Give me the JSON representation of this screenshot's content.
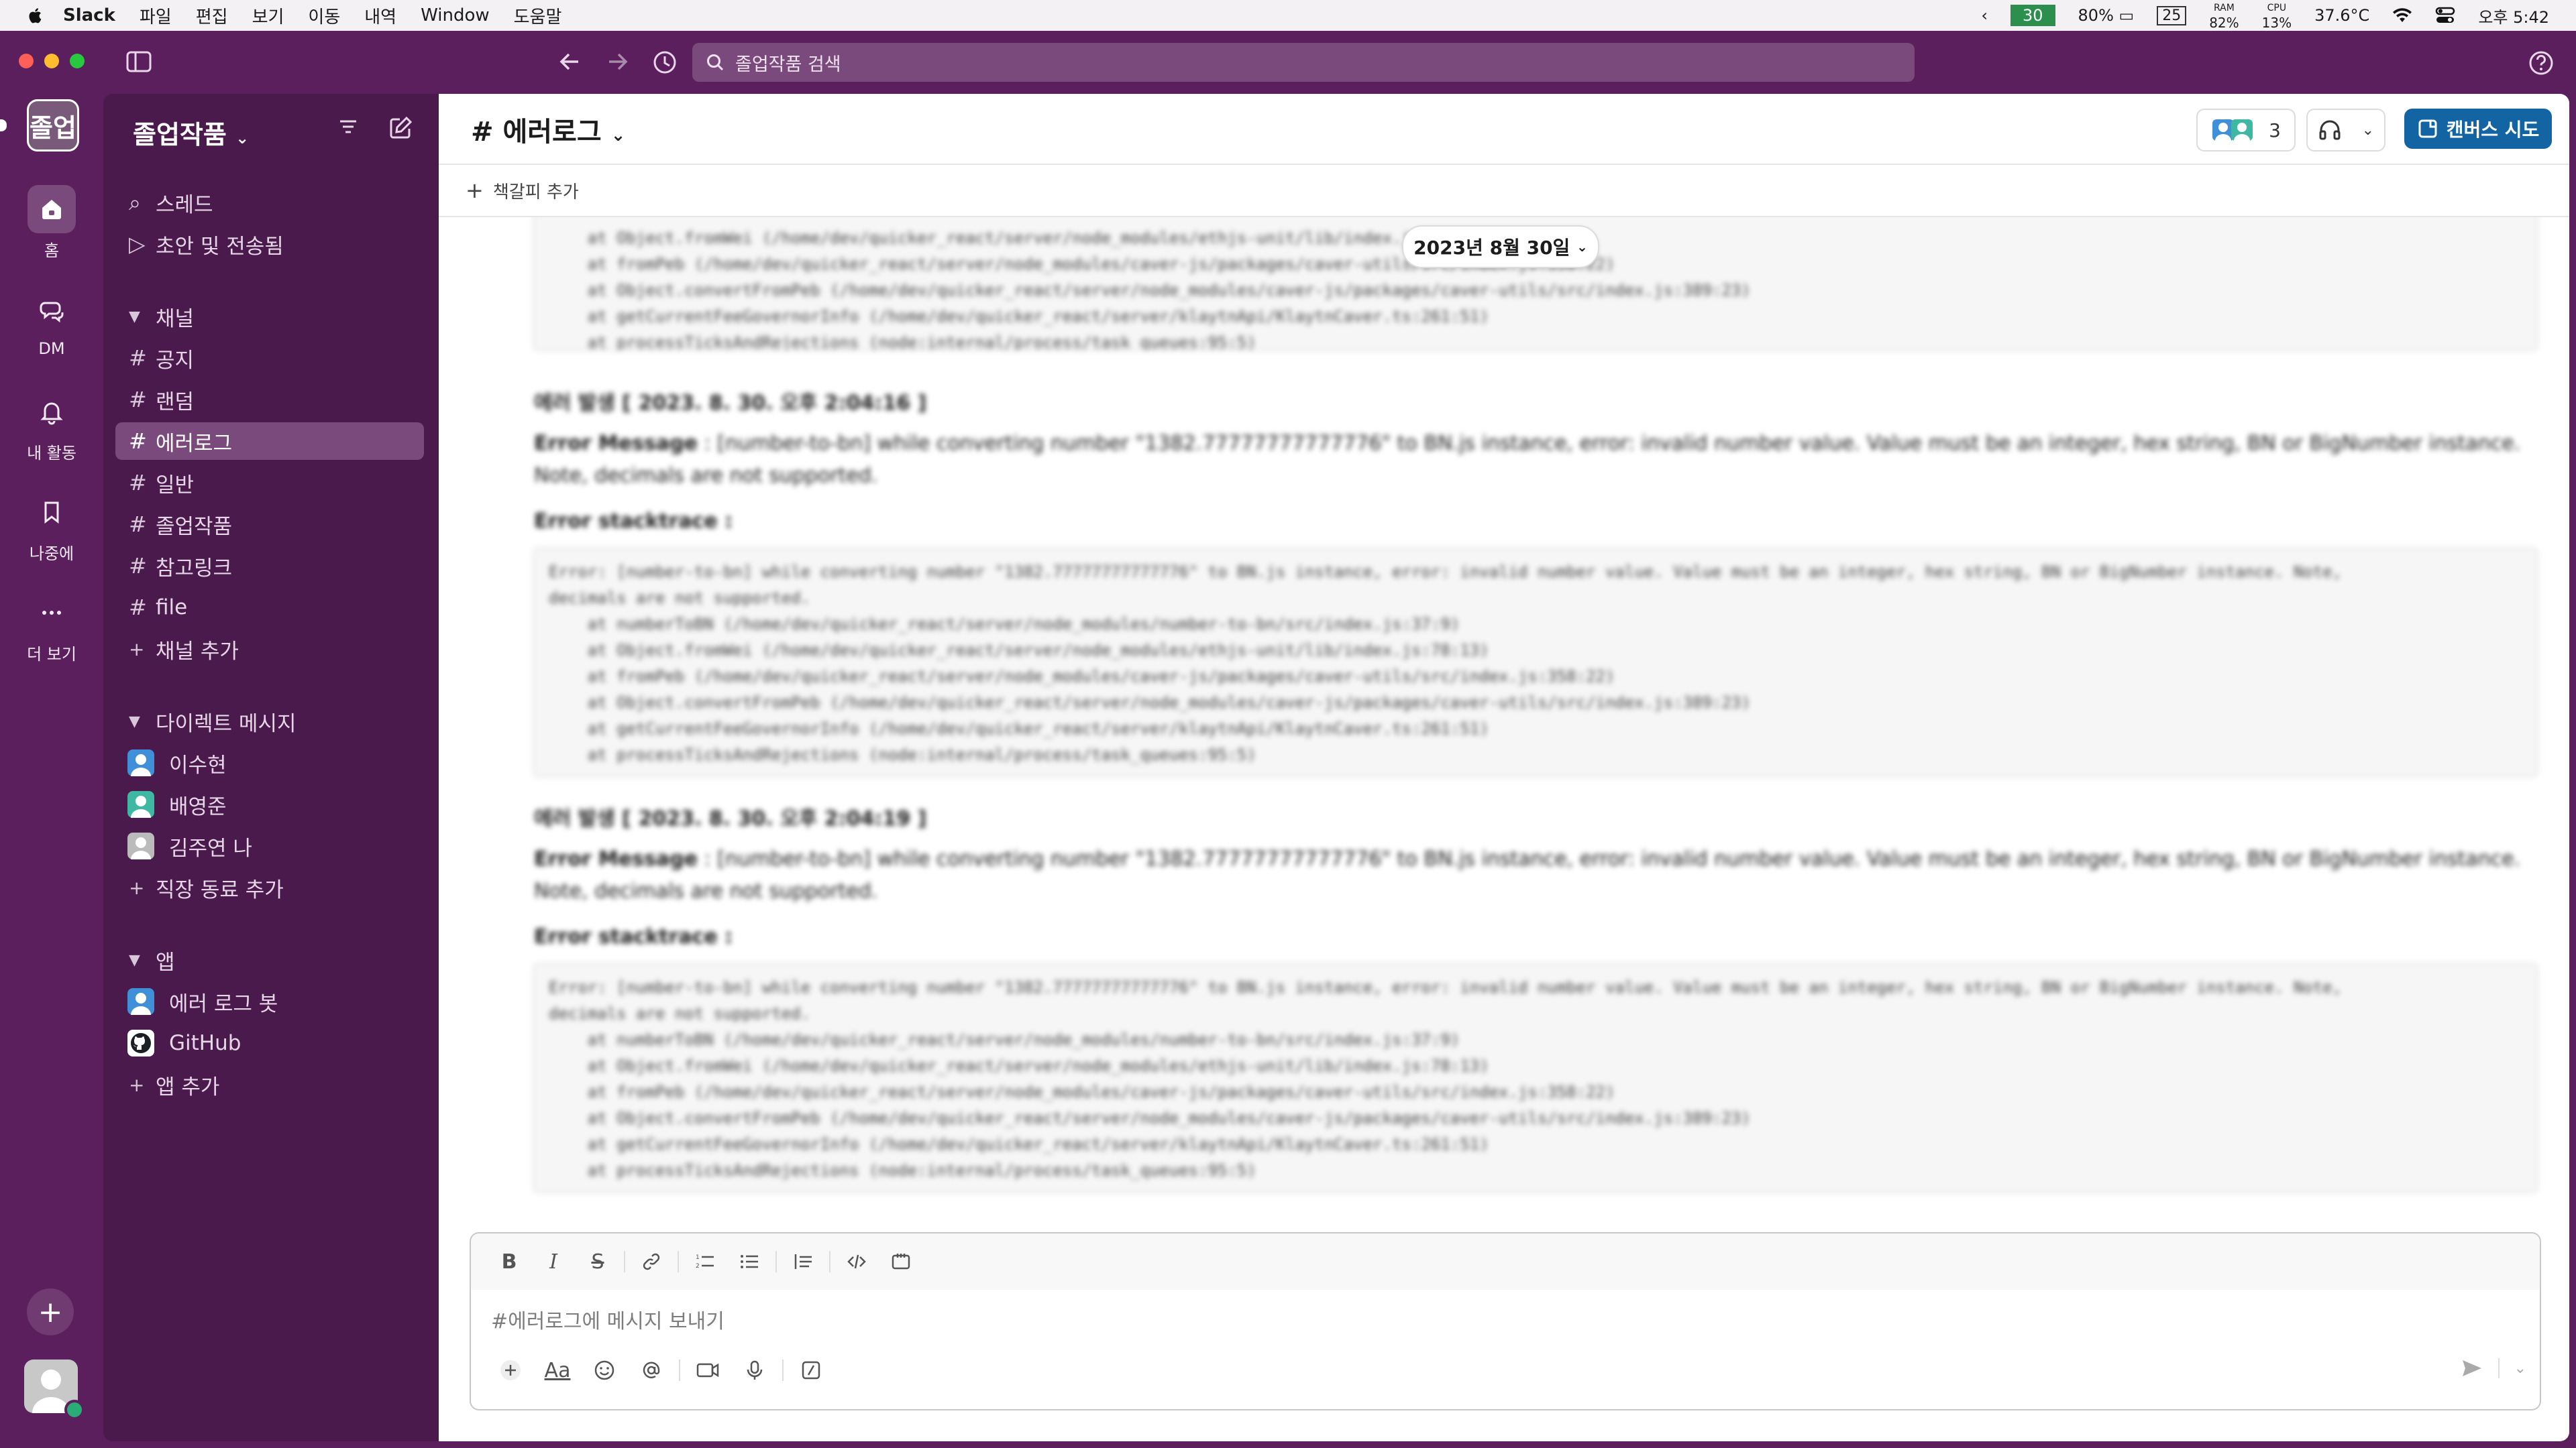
{
  "menubar": {
    "app": "Slack",
    "items": [
      "파일",
      "편집",
      "보기",
      "이동",
      "내역",
      "Window",
      "도움말"
    ],
    "cpu_temp_box": "30",
    "battery": "80%",
    "box_num": "25",
    "ram_label": "RAM",
    "ram": "82%",
    "cpu_label": "CPU",
    "cpu": "13%",
    "temp": "37.6°C",
    "time": "오후 5:42"
  },
  "titlebar": {
    "search_placeholder": "졸업작품 검색"
  },
  "rail": {
    "workspace_abbr": "졸업",
    "items": [
      {
        "label": "홈",
        "icon": "home-icon"
      },
      {
        "label": "DM",
        "icon": "dm-icon"
      },
      {
        "label": "내 활동",
        "icon": "bell-icon"
      },
      {
        "label": "나중에",
        "icon": "bookmark-icon"
      },
      {
        "label": "더 보기",
        "icon": "more-icon"
      }
    ]
  },
  "sidebar": {
    "workspace_name": "졸업작품",
    "top_items": [
      "스레드",
      "초안 및 전송됨"
    ],
    "channels_header": "채널",
    "channels": [
      "공지",
      "랜덤",
      "에러로그",
      "일반",
      "졸업작품",
      "참고링크",
      "file"
    ],
    "active_channel": "에러로그",
    "add_channel": "채널 추가",
    "dm_header": "다이렉트 메시지",
    "dms": [
      "이수현",
      "배영준",
      "김주연  나"
    ],
    "add_coworker": "직장 동료 추가",
    "apps_header": "앱",
    "apps": [
      "에러 로그 봇",
      "GitHub"
    ],
    "add_app": "앱 추가"
  },
  "channel": {
    "name": "# 에러로그",
    "member_count": "3",
    "canvas_button": "캔버스 시도",
    "bookmark_add": "책갈피 추가",
    "date_pill": "2023년 8월 30일"
  },
  "messages": {
    "top_trace": [
      "    at Object.fromWei (/home/dev/quicker_react/server/node_modules/ethjs-unit/lib/index.js:78:13)",
      "    at fromPeb (/home/dev/quicker_react/server/node_modules/caver-js/packages/caver-utils/src/index.js:358:22)",
      "    at Object.convertFromPeb (/home/dev/quicker_react/server/node_modules/caver-js/packages/caver-utils/src/index.js:389:23)",
      "    at getCurrentFeeGovernorInfo (/home/dev/quicker_react/server/klaytnApi/KlaytnCaver.ts:261:51)",
      "    at processTicksAndRejections (node:internal/process/task_queues:95:5)"
    ],
    "entries": [
      {
        "head": "에러 발생 [ 2023. 8. 30. 오후 2:04:16 ]",
        "message_label": "Error Message",
        "message": " : [number-to-bn] while converting number \"1382.77777777777776\" to BN.js instance, error: invalid number value. Value must be an integer, hex string, BN or BigNumber instance. Note, decimals are not supported.",
        "stack_label": "Error stacktrace :",
        "trace": [
          "Error: [number-to-bn] while converting number \"1382.77777777777776\" to BN.js instance, error: invalid number value. Value must be an integer, hex string, BN or BigNumber instance. Note,",
          "decimals are not supported.",
          "    at numberToBN (/home/dev/quicker_react/server/node_modules/number-to-bn/src/index.js:37:9)",
          "    at Object.fromWei (/home/dev/quicker_react/server/node_modules/ethjs-unit/lib/index.js:78:13)",
          "    at fromPeb (/home/dev/quicker_react/server/node_modules/caver-js/packages/caver-utils/src/index.js:358:22)",
          "    at Object.convertFromPeb (/home/dev/quicker_react/server/node_modules/caver-js/packages/caver-utils/src/index.js:389:23)",
          "    at getCurrentFeeGovernorInfo (/home/dev/quicker_react/server/klaytnApi/KlaytnCaver.ts:261:51)",
          "    at processTicksAndRejections (node:internal/process/task_queues:95:5)"
        ]
      },
      {
        "head": "에러 발생 [ 2023. 8. 30. 오후 2:04:19 ]",
        "message_label": "Error Message",
        "message": " : [number-to-bn] while converting number \"1382.77777777777776\" to BN.js instance, error: invalid number value. Value must be an integer, hex string, BN or BigNumber instance. Note, decimals are not supported.",
        "stack_label": "Error stacktrace :",
        "trace": [
          "Error: [number-to-bn] while converting number \"1382.77777777777776\" to BN.js instance, error: invalid number value. Value must be an integer, hex string, BN or BigNumber instance. Note,",
          "decimals are not supported.",
          "    at numberToBN (/home/dev/quicker_react/server/node_modules/number-to-bn/src/index.js:37:9)",
          "    at Object.fromWei (/home/dev/quicker_react/server/node_modules/ethjs-unit/lib/index.js:78:13)",
          "    at fromPeb (/home/dev/quicker_react/server/node_modules/caver-js/packages/caver-utils/src/index.js:358:22)",
          "    at Object.convertFromPeb (/home/dev/quicker_react/server/node_modules/caver-js/packages/caver-utils/src/index.js:389:23)",
          "    at getCurrentFeeGovernorInfo (/home/dev/quicker_react/server/klaytnApi/KlaytnCaver.ts:261:51)",
          "    at processTicksAndRejections (node:internal/process/task_queues:95:5)"
        ]
      }
    ]
  },
  "composer": {
    "placeholder": "#에러로그에 메시지 보내기",
    "format_buttons": [
      "B",
      "I",
      "S"
    ],
    "aa_label": "Aa"
  },
  "colors": {
    "aubergine": "#5a1f5c",
    "sidebar": "#491a4b",
    "active": "#7b4a7d",
    "canvas_blue": "#1264a3",
    "online": "#2bac76"
  }
}
